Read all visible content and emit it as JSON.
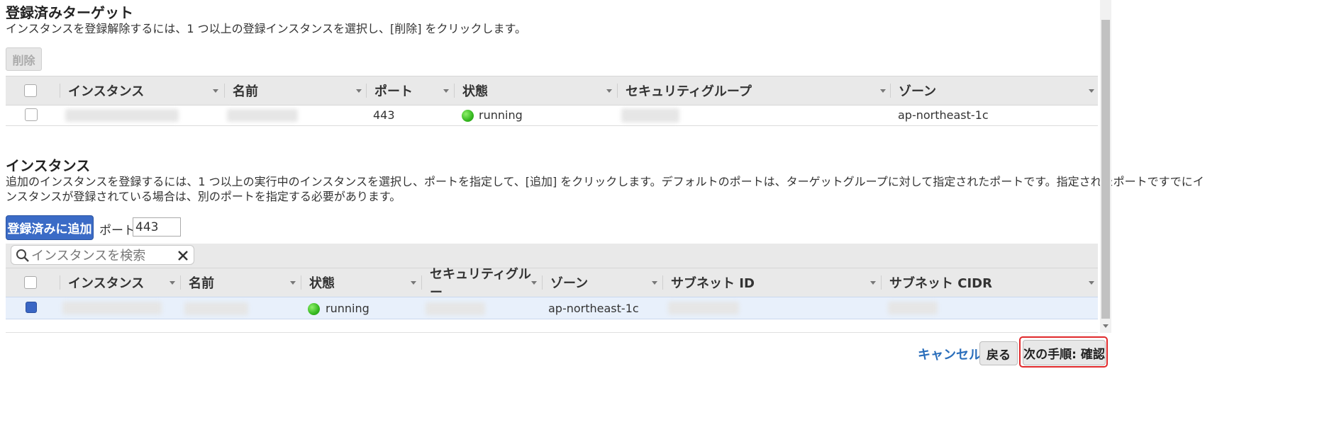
{
  "registered": {
    "title": "登録済みターゲット",
    "description": "インスタンスを登録解除するには、1 つ以上の登録インスタンスを選択し、[削除] をクリックします。",
    "remove_label": "削除",
    "columns": [
      "インスタンス",
      "名前",
      "ポート",
      "状態",
      "セキュリティグループ",
      "ゾーン"
    ],
    "rows": [
      {
        "port": "443",
        "status": "running",
        "zone": "ap-northeast-1c"
      }
    ]
  },
  "instances": {
    "title": "インスタンス",
    "description_line1": "追加のインスタンスを登録するには、1 つ以上の実行中のインスタンスを選択し、ポートを指定して、[追加] をクリックします。デフォルトのポートは、ターゲットグループに対して指定されたポートです。指定されたポートですでにイ",
    "description_line2": "ンスタンスが登録されている場合は、別のポートを指定する必要があります。",
    "add_label": "登録済みに追加",
    "port_label": "ポート",
    "port_value": "443",
    "search_placeholder": "インスタンスを検索",
    "columns": [
      "インスタンス",
      "名前",
      "状態",
      "セキュリティグルー",
      "ゾーン",
      "サブネット ID",
      "サブネット CIDR"
    ],
    "rows": [
      {
        "status": "running",
        "zone": "ap-northeast-1c",
        "selected": true
      }
    ]
  },
  "footer": {
    "cancel_label": "キャンセル",
    "back_label": "戻る",
    "next_label": "次の手順: 確認"
  },
  "colors": {
    "primary": "#3b6bc6",
    "link": "#2a6ebb",
    "highlight_border": "#e0292b",
    "status_running": "#35b81f"
  }
}
